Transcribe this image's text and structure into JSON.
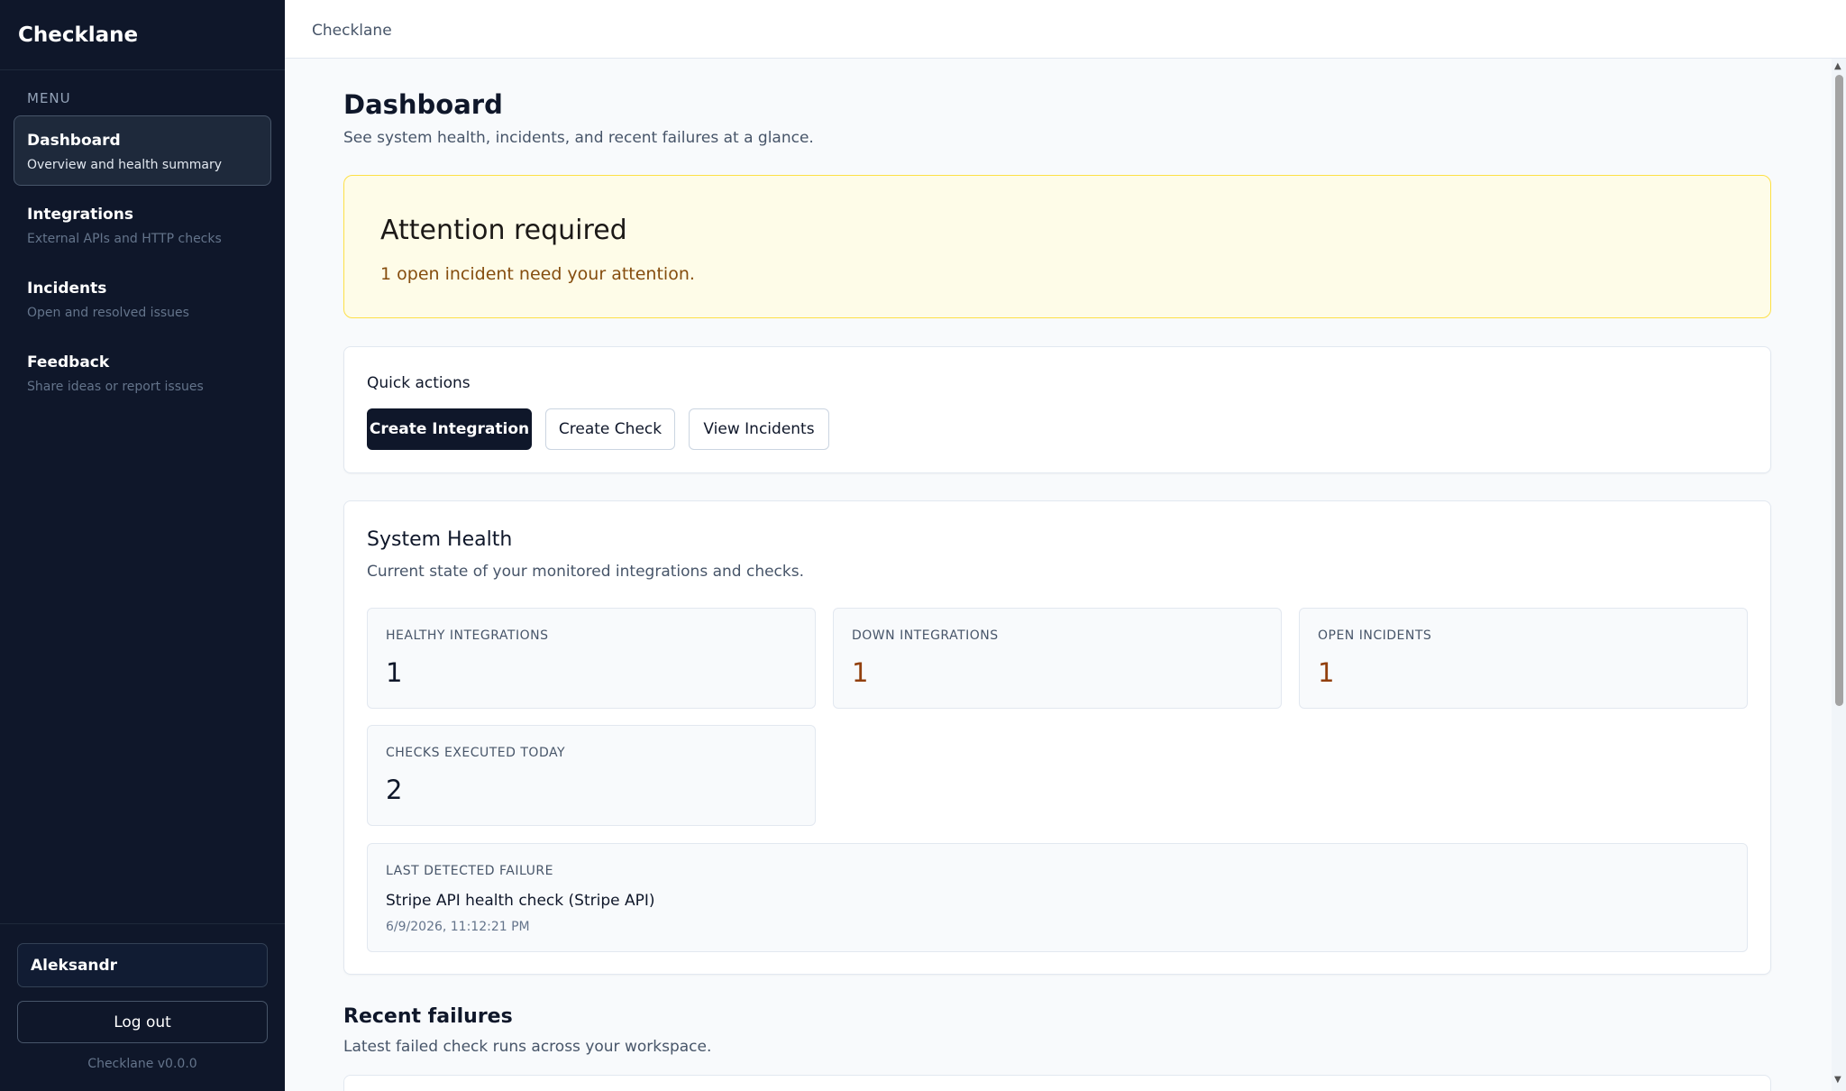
{
  "app": {
    "name": "Checklane",
    "version": "Checklane v0.0.0"
  },
  "sidebar": {
    "menu_label": "MENU",
    "items": [
      {
        "title": "Dashboard",
        "subtitle": "Overview and health summary",
        "active": true
      },
      {
        "title": "Integrations",
        "subtitle": "External APIs and HTTP checks",
        "active": false
      },
      {
        "title": "Incidents",
        "subtitle": "Open and resolved issues",
        "active": false
      },
      {
        "title": "Feedback",
        "subtitle": "Share ideas or report issues",
        "active": false
      }
    ],
    "user_name": "Aleksandr",
    "logout_label": "Log out"
  },
  "topbar": {
    "breadcrumb": "Checklane"
  },
  "page": {
    "title": "Dashboard",
    "subtitle": "See system health, incidents, and recent failures at a glance."
  },
  "attention": {
    "title": "Attention required",
    "text": "1 open incident need your attention."
  },
  "quick_actions": {
    "label": "Quick actions",
    "create_integration": "Create Integration",
    "create_check": "Create Check",
    "view_incidents": "View Incidents"
  },
  "health": {
    "title": "System Health",
    "subtitle": "Current state of your monitored integrations and checks.",
    "stats": [
      {
        "label": "HEALTHY INTEGRATIONS",
        "value": "1"
      },
      {
        "label": "DOWN INTEGRATIONS",
        "value": "1"
      },
      {
        "label": "OPEN INCIDENTS",
        "value": "1"
      },
      {
        "label": "CHECKS EXECUTED TODAY",
        "value": "2"
      }
    ],
    "last_failure": {
      "label": "LAST DETECTED FAILURE",
      "name": "Stripe API health check (Stripe API)",
      "time": "6/9/2026, 11:12:21 PM"
    }
  },
  "recent": {
    "title": "Recent failures",
    "subtitle": "Latest failed check runs across your workspace."
  },
  "colors": {
    "sidebar_bg": "#0f172a",
    "attention_bg": "#fefce8",
    "attention_border": "#fde047",
    "warn_value": "#92400e",
    "primary_button": "#0f172a"
  }
}
